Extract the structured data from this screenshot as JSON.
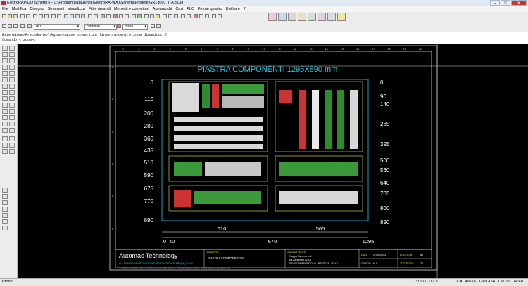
{
  "window": {
    "title": "ElettroRAPIDO Schemi 6 - C:\\ProgramData\\Antek\\ElettroRAPIDO\\Schemi\\Progetti\\GR13001_ITA.SCH",
    "minimize": "–",
    "maximize": "□",
    "close": "✕"
  },
  "menu": [
    "File",
    "Modifica",
    "Disegno",
    "Strumenti",
    "Visualizza",
    "Fili e rimandi",
    "Morsetti e connettori",
    "Apparecchi",
    "Cavi",
    "PLC",
    "Fronte quadro",
    "Unifilare",
    "?"
  ],
  "toolbar2": {
    "layer_value": "0/0",
    "linetype_value": "continuo",
    "color_value": "rosso"
  },
  "command": {
    "history": "Estensione/Precedente/pAgina/rapporto/vertice finestra/centro zoom dinamico: Z",
    "prompt": "Comando <_zoom>:"
  },
  "drawing": {
    "plate_title": "PIASTRA COMPONENTI 1295X890 mm",
    "left_dims": [
      "0",
      "110",
      "200",
      "280",
      "360",
      "435",
      "510",
      "590",
      "675",
      "770",
      "890"
    ],
    "right_dims": [
      "0",
      "90",
      "140",
      "265",
      "395",
      "500",
      "560",
      "640",
      "705",
      "800",
      "890"
    ],
    "bottom_dims_top": [
      "610",
      "565"
    ],
    "bottom_dims_bottom": [
      "0",
      "40",
      "670",
      "1295"
    ],
    "column_numbers": [
      "1",
      "2",
      "3",
      "4",
      "5",
      "6",
      "7",
      "8",
      "9",
      "10",
      "11",
      "12",
      "13",
      "14",
      "15",
      "16",
      "17",
      "18",
      "19",
      "20"
    ],
    "row_letters": [
      "A",
      "B",
      "C",
      "D",
      "E",
      "F"
    ],
    "company": "Automac Technology",
    "company_address": "VIA MONTEVIANTE 11/13   CAP 25010 MONTICHIARI (BS) ITALY",
    "oggetto_label": "OGGETTO",
    "oggetto_value": "PIASTRA COMPONENTI  E",
    "committente_label": "COMMITTENTE",
    "committente_value": "Gruppo Gamma s.r.l.",
    "committente_addr1": "Via Zanardelli 12/18",
    "committente_addr2": "25010 CARPENEDOLO - BRESCIA - ITALY",
    "data_label": "DATA",
    "data_value": "17/09/2013",
    "foglio_label": "FOGLIO N°",
    "foglio_value": "69",
    "disegn_label": "DISEGN.",
    "disegn_value": "M.L.",
    "totfogli_label": "TOT. FOGLI",
    "totfogli_value": "77",
    "footer_note": "IL PRESENTE DISEGNO È PROPRIETÀ DI AUTOMAC, È VIETATA LA RIPRODUZIONE ANCHE PARZIALE SENZA AUTORIZZAZIONE"
  },
  "status": {
    "left": "Pronto",
    "coords": "315.00,117.37",
    "calamita": "CALAMITA",
    "griglia": "GRIGLIA",
    "orto": "ORTO",
    "time": "14:40"
  },
  "colors": {
    "canvas_bg": "#000000",
    "frame": "#d8d8d8",
    "cyan": "#29c6e6",
    "white_text": "#ffffff",
    "yellow": "#e8e84a"
  }
}
